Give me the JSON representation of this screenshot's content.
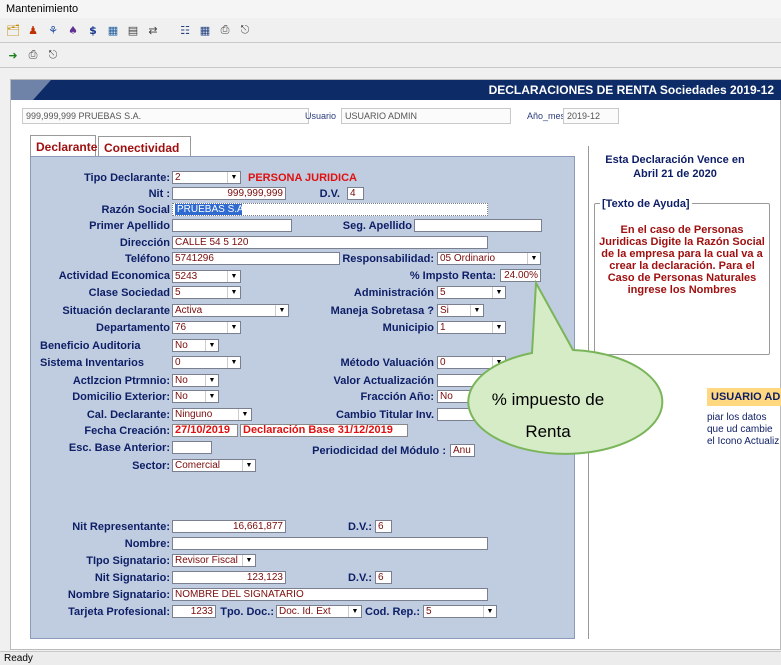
{
  "menubar": {
    "title": "Mantenimiento"
  },
  "window": {
    "title": "DECLARACIONES DE RENTA Sociedades 2019-12"
  },
  "infobar": {
    "company": "999,999,999 PRUEBAS S.A.",
    "usuario_label": "Usuario",
    "usuario_value": "USUARIO ADMIN",
    "anomes_label": "Año_mes",
    "anomes_value": "2019-12"
  },
  "tabs": {
    "declarante": "Declarante",
    "conectividad": "Conectividad"
  },
  "form": {
    "tipo_declarante_label": "Tipo Declarante:",
    "tipo_declarante_value": "2",
    "tipo_declarante_desc": "PERSONA JURIDICA",
    "nit_label": "Nit :",
    "nit_value": "999,999,999",
    "dv_label": "D.V.",
    "dv_value": "4",
    "razon_label": "Razón Social",
    "razon_value": "PRUEBAS S.A.",
    "primer_apellido_label": "Primer Apellido",
    "seg_apellido_label": "Seg. Apellido",
    "direccion_label": "Dirección",
    "direccion_value": "CALLE 54 5 120",
    "telefono_label": "Teléfono",
    "telefono_value": "5741296",
    "responsabilidad_label": "Responsabilidad:",
    "responsabilidad_value": "05 Ordinario",
    "actividad_label": "Actividad Economica",
    "actividad_value": "5243",
    "impsto_label": "% Impsto Renta:",
    "impsto_value": "24.00%",
    "clase_label": "Clase Sociedad",
    "clase_value": "5",
    "administracion_label": "Administración",
    "administracion_value": "5",
    "situacion_label": "Situación declarante",
    "situacion_value": "Activa",
    "sobretasa_label": "Maneja Sobretasa ?",
    "sobretasa_value": "Si",
    "departamento_label": "Departamento",
    "departamento_value": "76",
    "municipio_label": "Municipio",
    "municipio_value": "1",
    "beneficio_label": "Beneficio Auditoria",
    "beneficio_value": "No",
    "inventarios_label": "Sistema Inventarios",
    "inventarios_value": "0",
    "metodo_label": "Método Valuación",
    "metodo_value": "0",
    "actlzcion_label": "Actlzcion Ptrmnio:",
    "actlzcion_value": "No",
    "valor_act_label": "Valor Actualización",
    "domicilio_label": "Domicilio Exterior:",
    "domicilio_value": "No",
    "fraccion_label": "Fracción Año:",
    "fraccion_value": "No",
    "cal_label": "Cal. Declarante:",
    "cal_value": "Ninguno",
    "cambio_label": "Cambio Titular Inv.",
    "fecha_label": "Fecha Creación:",
    "fecha_value": "27/10/2019",
    "decl_base": "Declaración Base 31/12/2019",
    "esc_label": "Esc. Base Anterior:",
    "periodicidad_label": "Periodicidad del Módulo :",
    "periodicidad_value": "Anu",
    "sector_label": "Sector:",
    "sector_value": "Comercial",
    "nit_rep_label": "Nit Representante:",
    "nit_rep_value": "16,661,877",
    "dv2_label": "D.V.:",
    "dv2_value": "6",
    "nombre_label": "Nombre:",
    "tipo_sig_label": "TIpo Signatario:",
    "tipo_sig_value": "Revisor Fiscal",
    "nit_sig_label": "Nit Signatario:",
    "nit_sig_value": "123,123",
    "dv3_label": "D.V.:",
    "dv3_value": "6",
    "nombre_sig_label": "Nombre Signatario:",
    "nombre_sig_value": "NOMBRE DEL SIGNATARIO",
    "tarjeta_label": "Tarjeta Profesional:",
    "tarjeta_value": "1233",
    "tpo_doc_label": "Tpo. Doc.:",
    "tpo_doc_value": "Doc. Id. Ext",
    "cod_rep_label": "Cod. Rep.:",
    "cod_rep_value": "5"
  },
  "side": {
    "vence_line1": "Esta Declaración Vence en",
    "vence_line2": "Abril 21 de 2020",
    "help_title": "[Texto de Ayuda]",
    "help_text": "En el caso de Personas Juridicas Digite la Razón Social de la empresa para la cual va a crear la declaración. Para el Caso de Personas Naturales ingrese los Nombres",
    "adm_label": "USUARIO ADM",
    "adm_line1": "piar los datos",
    "adm_line2": "que ud cambie",
    "adm_line3": "el Icono Actualiz"
  },
  "callout": {
    "line1": "% impuesto de",
    "line2": "Renta"
  },
  "status": {
    "text": "Ready"
  },
  "icons": [
    "folder-open-icon",
    "people-icon",
    "user-search-icon",
    "users-icon",
    "dollar-icon",
    "calculator-icon",
    "document-icon",
    "transfer-icon",
    "tree-icon",
    "calendar-icon",
    "printer-icon",
    "exit-icon",
    "import-icon",
    "printer-icon",
    "exit-icon"
  ]
}
